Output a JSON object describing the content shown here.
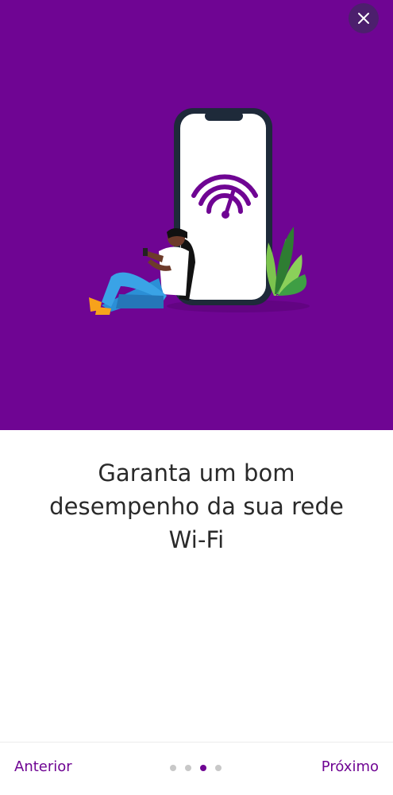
{
  "hero": {
    "background_color": "#6f0593",
    "illustration_icon": "wifi-phone-person-illustration"
  },
  "close_button": {
    "icon": "close-icon"
  },
  "content": {
    "headline_lines": [
      "Garanta um bom",
      "desempenho da sua rede",
      "Wi-Fi"
    ]
  },
  "footer": {
    "previous_label": "Anterior",
    "next_label": "Próximo",
    "page_count": 4,
    "current_page": 3,
    "accent_color": "#6f0593"
  }
}
